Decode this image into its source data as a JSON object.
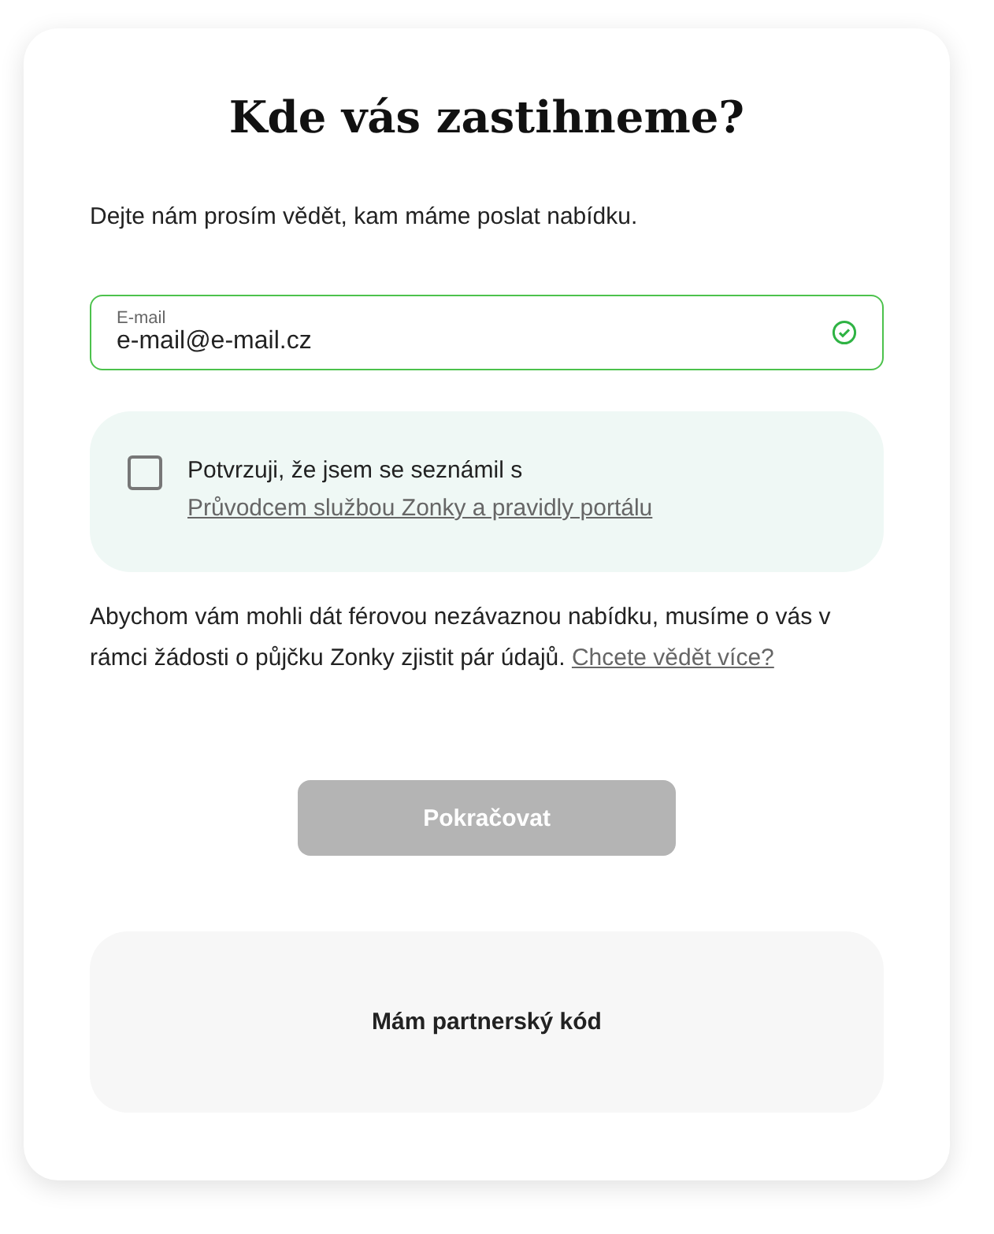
{
  "title": "Kde vás zastihneme?",
  "intro": "Dejte nám prosím vědět, kam máme poslat nabídku.",
  "email": {
    "label": "E-mail",
    "value": "e-mail@e-mail.cz",
    "valid": true
  },
  "consent": {
    "text": "Potvrzuji, že jsem se seznámil s",
    "link": "Průvodcem službou Zonky a pravidly portálu",
    "checked": false
  },
  "info": {
    "text": "Abychom vám mohli dát férovou nezávaznou nabídku, musíme o vás v rámci žádosti o půjčku Zonky zjistit pár údajů.",
    "link": "Chcete vědět více?"
  },
  "continue_button": {
    "label": "Pokračovat",
    "disabled": true
  },
  "partner": {
    "label": "Mám partnerský kód"
  }
}
